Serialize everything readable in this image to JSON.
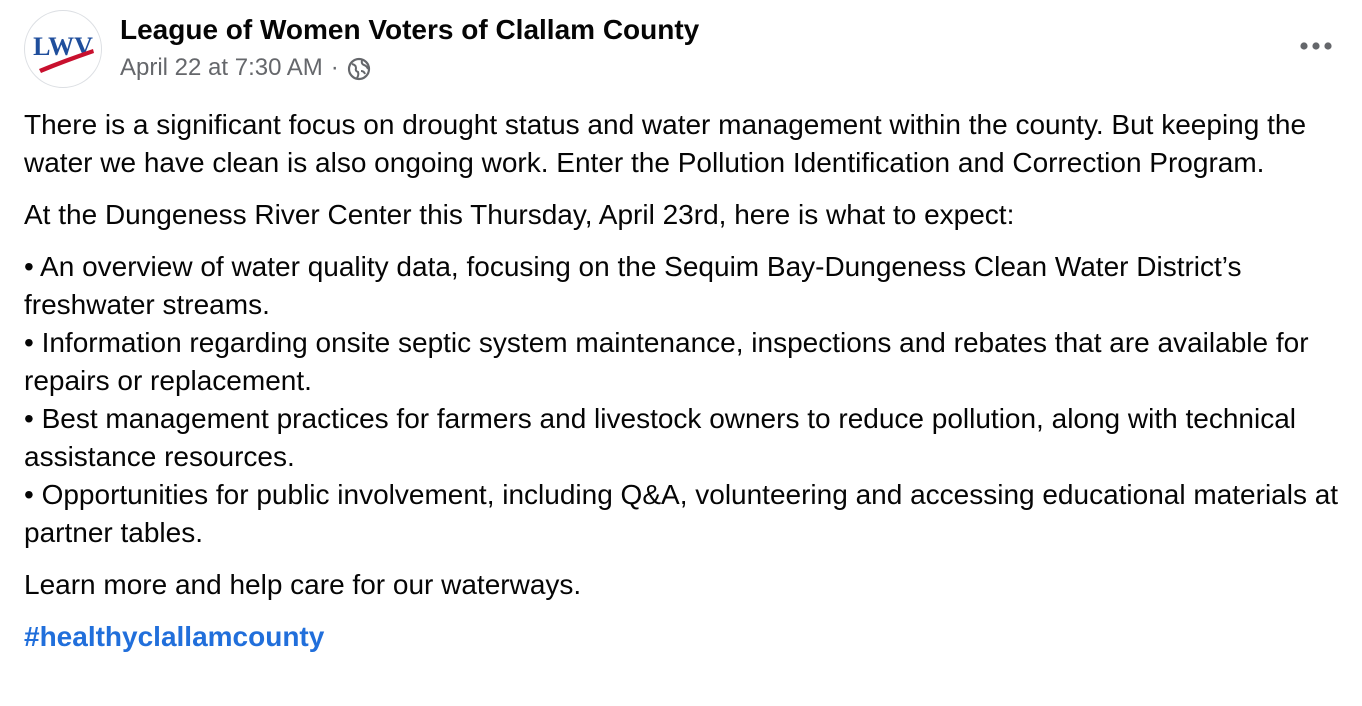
{
  "post": {
    "author": "League of Women Voters of Clallam County",
    "timestamp": "April 22 at 7:30 AM",
    "separator": "·",
    "privacy_icon": "globe-icon",
    "more_icon": "more-options-icon",
    "avatar_text": "LWV",
    "paragraph1": "There is a significant focus on drought status and water management within the county.   But keeping the water we have clean is also ongoing work.  Enter the Pollution Identification and Correction Program.",
    "paragraph2": "At the Dungeness River Center this Thursday, April 23rd, here is what to expect:",
    "bullets": [
      "• An overview of water quality data, focusing on the Sequim Bay-Dungeness Clean Water District’s freshwater streams.",
      "• Information regarding onsite septic system maintenance, inspections and rebates that are available for repairs or replacement.",
      "• Best management practices for farmers and livestock owners to reduce pollution, along with technical assistance resources.",
      "• Opportunities for public involvement, including Q&A, volunteering and accessing educational materials at partner tables."
    ],
    "paragraph3": "Learn more and help care for our waterways.",
    "hashtag": "#healthyclallamcounty"
  },
  "colors": {
    "hashtag": "#216fdb",
    "meta": "#65676b",
    "logo_blue": "#1f4e9c",
    "logo_red": "#c8102e"
  }
}
